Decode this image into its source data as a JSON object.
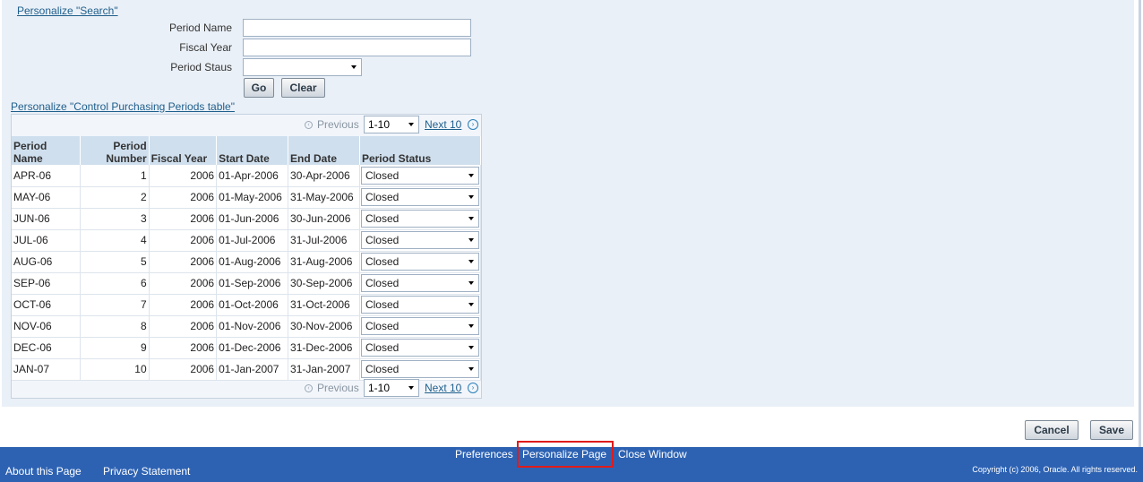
{
  "search_region": {
    "personalize_link": "Personalize \"Search\"",
    "fields": {
      "period_name_label": "Period Name",
      "fiscal_year_label": "Fiscal Year",
      "period_status_label": "Period Staus",
      "period_name_value": "",
      "fiscal_year_value": "",
      "period_status_value": ""
    },
    "go_label": "Go",
    "clear_label": "Clear"
  },
  "table_region": {
    "personalize_link": "Personalize \"Control Purchasing Periods table\"",
    "nav": {
      "previous": "Previous",
      "range": "1-10",
      "next": "Next 10"
    },
    "headers": [
      "Period Name",
      "Period Number",
      "Fiscal Year",
      "Start Date",
      "End Date",
      "Period Status"
    ],
    "rows": [
      {
        "name": "APR-06",
        "number": "1",
        "year": "2006",
        "start": "01-Apr-2006",
        "end": "30-Apr-2006",
        "status": "Closed"
      },
      {
        "name": "MAY-06",
        "number": "2",
        "year": "2006",
        "start": "01-May-2006",
        "end": "31-May-2006",
        "status": "Closed"
      },
      {
        "name": "JUN-06",
        "number": "3",
        "year": "2006",
        "start": "01-Jun-2006",
        "end": "30-Jun-2006",
        "status": "Closed"
      },
      {
        "name": "JUL-06",
        "number": "4",
        "year": "2006",
        "start": "01-Jul-2006",
        "end": "31-Jul-2006",
        "status": "Closed"
      },
      {
        "name": "AUG-06",
        "number": "5",
        "year": "2006",
        "start": "01-Aug-2006",
        "end": "31-Aug-2006",
        "status": "Closed"
      },
      {
        "name": "SEP-06",
        "number": "6",
        "year": "2006",
        "start": "01-Sep-2006",
        "end": "30-Sep-2006",
        "status": "Closed"
      },
      {
        "name": "OCT-06",
        "number": "7",
        "year": "2006",
        "start": "01-Oct-2006",
        "end": "31-Oct-2006",
        "status": "Closed"
      },
      {
        "name": "NOV-06",
        "number": "8",
        "year": "2006",
        "start": "01-Nov-2006",
        "end": "30-Nov-2006",
        "status": "Closed"
      },
      {
        "name": "DEC-06",
        "number": "9",
        "year": "2006",
        "start": "01-Dec-2006",
        "end": "31-Dec-2006",
        "status": "Closed"
      },
      {
        "name": "JAN-07",
        "number": "10",
        "year": "2006",
        "start": "01-Jan-2007",
        "end": "31-Jan-2007",
        "status": "Closed"
      }
    ]
  },
  "actions": {
    "cancel_label": "Cancel",
    "save_label": "Save"
  },
  "footer": {
    "preferences": "Preferences",
    "personalize_page": "Personalize Page",
    "close_window": "Close Window",
    "about": "About this Page",
    "privacy": "Privacy Statement",
    "copyright": "Copyright (c) 2006, Oracle. All rights reserved."
  },
  "colors": {
    "footer_bg": "#2d62b3",
    "highlight": "#e01b1b",
    "link": "#1f5f8c",
    "header_bg": "#cfdfee"
  }
}
